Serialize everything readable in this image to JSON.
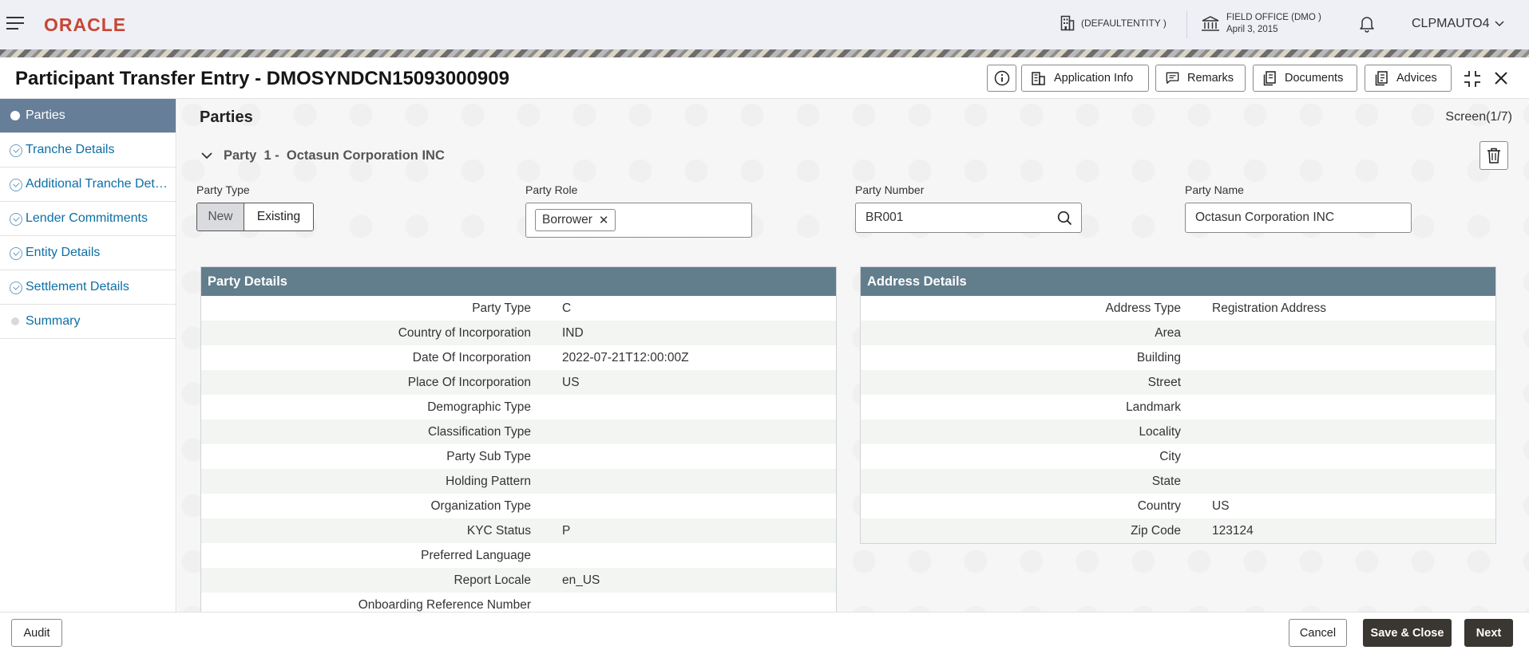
{
  "header": {
    "logo": "ORACLE",
    "entity": "(DEFAULTENTITY )",
    "office_name": "FIELD OFFICE (DMO )",
    "office_date": "April 3, 2015",
    "user": "CLPMAUTO4"
  },
  "titlebar": {
    "title": "Participant Transfer Entry - DMOSYNDCN15093000909",
    "buttons": {
      "application_info": "Application Info",
      "remarks": "Remarks",
      "documents": "Documents",
      "advices": "Advices"
    }
  },
  "sidebar": {
    "items": [
      {
        "label": "Parties",
        "state": "active"
      },
      {
        "label": "Tranche Details",
        "state": "done"
      },
      {
        "label": "Additional Tranche Det…",
        "state": "done"
      },
      {
        "label": "Lender Commitments",
        "state": "done"
      },
      {
        "label": "Entity Details",
        "state": "done"
      },
      {
        "label": "Settlement Details",
        "state": "done"
      },
      {
        "label": "Summary",
        "state": "pending"
      }
    ]
  },
  "main": {
    "section_title": "Parties",
    "screen_counter": "Screen(1/7)",
    "party_header": "Party  1 -  Octasun Corporation INC",
    "fields": {
      "party_type_label": "Party Type",
      "party_type_options": [
        "New",
        "Existing"
      ],
      "party_type_selected": "Existing",
      "party_role_label": "Party Role",
      "party_role_chip": "Borrower",
      "party_number_label": "Party Number",
      "party_number_value": "BR001",
      "party_name_label": "Party Name",
      "party_name_value": "Octasun Corporation INC"
    },
    "party_details": {
      "title": "Party Details",
      "rows": [
        {
          "k": "Party Type",
          "v": "C"
        },
        {
          "k": "Country of Incorporation",
          "v": "IND"
        },
        {
          "k": "Date Of Incorporation",
          "v": "2022-07-21T12:00:00Z"
        },
        {
          "k": "Place Of Incorporation",
          "v": "US"
        },
        {
          "k": "Demographic Type",
          "v": ""
        },
        {
          "k": "Classification Type",
          "v": ""
        },
        {
          "k": "Party Sub Type",
          "v": ""
        },
        {
          "k": "Holding Pattern",
          "v": ""
        },
        {
          "k": "Organization Type",
          "v": ""
        },
        {
          "k": "KYC Status",
          "v": "P"
        },
        {
          "k": "Preferred Language",
          "v": ""
        },
        {
          "k": "Report Locale",
          "v": "en_US"
        },
        {
          "k": "Onboarding Reference Number",
          "v": ""
        }
      ]
    },
    "address_details": {
      "title": "Address Details",
      "rows": [
        {
          "k": "Address Type",
          "v": "Registration Address"
        },
        {
          "k": "Area",
          "v": ""
        },
        {
          "k": "Building",
          "v": ""
        },
        {
          "k": "Street",
          "v": ""
        },
        {
          "k": "Landmark",
          "v": ""
        },
        {
          "k": "Locality",
          "v": ""
        },
        {
          "k": "City",
          "v": ""
        },
        {
          "k": "State",
          "v": ""
        },
        {
          "k": "Country",
          "v": "US"
        },
        {
          "k": "Zip Code",
          "v": "123124"
        }
      ]
    }
  },
  "footer": {
    "audit": "Audit",
    "cancel": "Cancel",
    "save_close": "Save & Close",
    "next": "Next"
  },
  "colors": {
    "brand_red": "#c74634",
    "panel_header": "#627d8c",
    "nav_active": "#667e98",
    "link_blue": "#0c6fa6",
    "primary_button": "#3a3631"
  }
}
